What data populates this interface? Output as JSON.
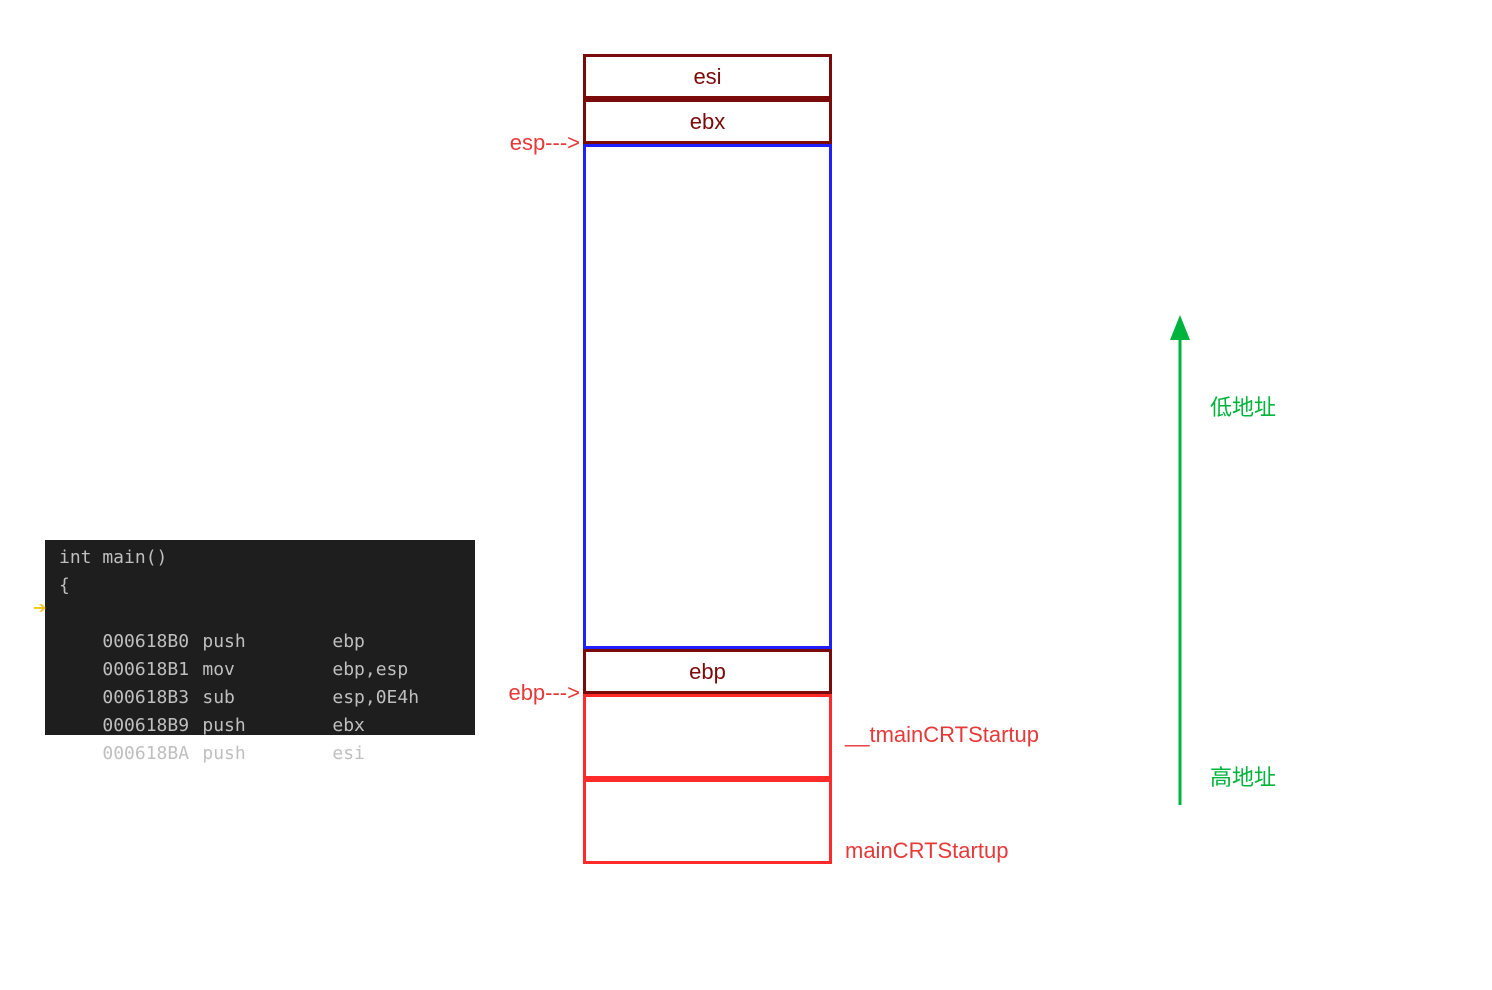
{
  "code": {
    "header1": "int main()",
    "header2": "{",
    "lines": [
      {
        "addr": "000618B0",
        "mnem": "push",
        "op": "ebp"
      },
      {
        "addr": "000618B1",
        "mnem": "mov",
        "op": "ebp,esp"
      },
      {
        "addr": "000618B3",
        "mnem": "sub",
        "op": "esp,0E4h"
      },
      {
        "addr": "000618B9",
        "mnem": "push",
        "op": "ebx"
      },
      {
        "addr": "000618BA",
        "mnem": "push",
        "op": "esi"
      }
    ]
  },
  "pointers": {
    "esp": "esp--->",
    "ebp": "ebp--->"
  },
  "stack": {
    "esi": "esi",
    "ebx": "ebx",
    "ebp": "ebp"
  },
  "functions": {
    "tmain": "__tmainCRTStartup",
    "main": "mainCRTStartup"
  },
  "addr_labels": {
    "low": "低地址",
    "high": "高地址"
  }
}
